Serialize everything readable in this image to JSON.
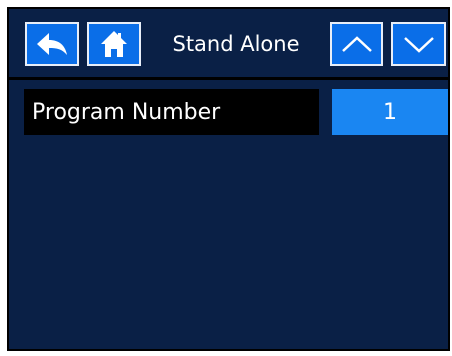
{
  "header": {
    "title": "Stand Alone",
    "buttons": {
      "back": "back-arrow-icon",
      "home": "home-icon",
      "up": "chevron-up-icon",
      "down": "chevron-down-icon"
    }
  },
  "settings": [
    {
      "label": "Program Number",
      "value": "1"
    }
  ],
  "colors": {
    "background": "#0a2046",
    "button": "#0a6ee8",
    "value_field": "#1a86f2",
    "label_field": "#000000"
  }
}
